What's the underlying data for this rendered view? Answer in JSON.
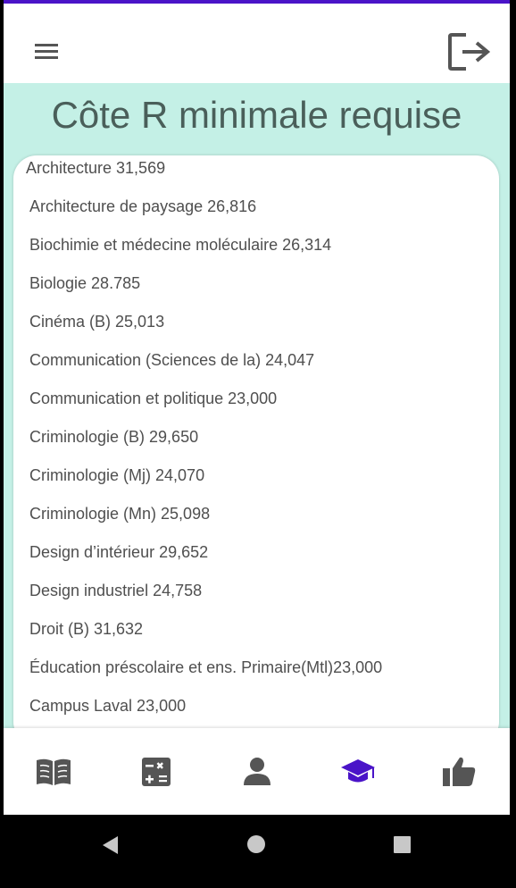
{
  "header": {
    "menu_icon": "hamburger-menu-icon",
    "logout_icon": "logout-icon"
  },
  "page": {
    "title": "Côte R minimale requise"
  },
  "programs": [
    "Architecture 31,569",
    "Architecture de paysage 26,816",
    "Biochimie et médecine moléculaire 26,314",
    "Biologie 28.785",
    "Cinéma (B) 25,013",
    "Communication (Sciences de la) 24,047",
    "Communication et politique 23,000",
    "Criminologie (B) 29,650",
    "Criminologie (Mj) 24,070",
    "Criminologie (Mn) 25,098",
    "Design d’intérieur 29,652",
    "Design industriel 24,758",
    "Droit (B) 31,632",
    "Éducation préscolaire et ens. Primaire(Mtl)23,000",
    "Campus Laval 23,000"
  ],
  "bottom_nav": {
    "items": [
      {
        "icon": "book-icon",
        "active": false
      },
      {
        "icon": "calculator-icon",
        "active": false
      },
      {
        "icon": "person-icon",
        "active": false
      },
      {
        "icon": "graduation-cap-icon",
        "active": true
      },
      {
        "icon": "thumbs-up-icon",
        "active": false
      }
    ]
  },
  "system_nav": [
    "back-icon",
    "home-icon",
    "recents-icon"
  ],
  "colors": {
    "accent": "#4a14c8",
    "content_background": "#c4f0e6",
    "title": "#4a5f5a",
    "icon_inactive": "#555555",
    "icon_active": "#4a14c8"
  }
}
